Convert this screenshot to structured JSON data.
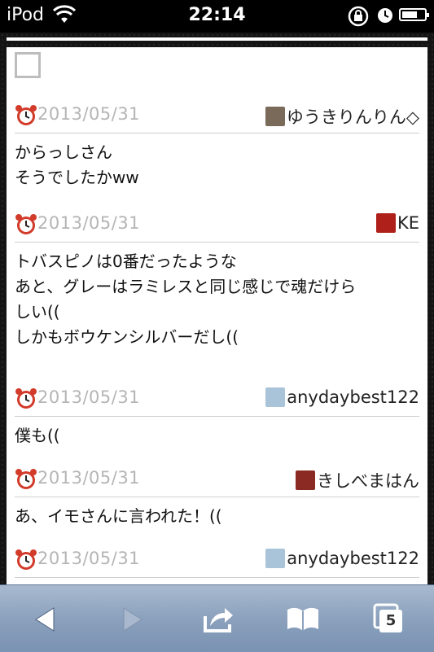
{
  "status_bar": {
    "carrier": "iPod",
    "time": "22:14",
    "icons": [
      "wifi-icon",
      "rotation-lock-icon",
      "clock-icon",
      "battery-icon"
    ]
  },
  "posts": [
    {
      "lines": [],
      "has_empty_box": true,
      "date": "2013/05/31",
      "author": "ゆうきりんりん◇",
      "avatar_color": "#7a6a5a"
    },
    {
      "lines": [
        "からっしさん",
        "そうでしたかww"
      ],
      "date": "2013/05/31",
      "author": "KE",
      "avatar_color": "#b0201a"
    },
    {
      "lines": [
        "トバスピノは0番だったような",
        "あと、グレーはラミレスと同じ感じで魂だけら",
        "しい((",
        "しかもボウケンシルバーだし(("
      ],
      "date": "2013/05/31",
      "author": "anydaybest122",
      "avatar_color": "#a9c3d9"
    },
    {
      "lines": [
        "僕も(("
      ],
      "date": "2013/05/31",
      "author": "きしべまはん",
      "avatar_color": "#8a2a22"
    },
    {
      "lines": [
        "あ、イモさんに言われた！(("
      ],
      "date": "2013/05/31",
      "author": "anydaybest122",
      "avatar_color": "#a9c3d9"
    }
  ],
  "toolbar": {
    "tabs_count": "5",
    "icons": [
      "back-icon",
      "forward-icon",
      "share-icon",
      "bookmarks-icon",
      "tabs-icon"
    ]
  },
  "colors": {
    "toolbar": "#8ba1bd",
    "date_text": "#b5b5b5",
    "clock_red": "#d23a2a"
  }
}
